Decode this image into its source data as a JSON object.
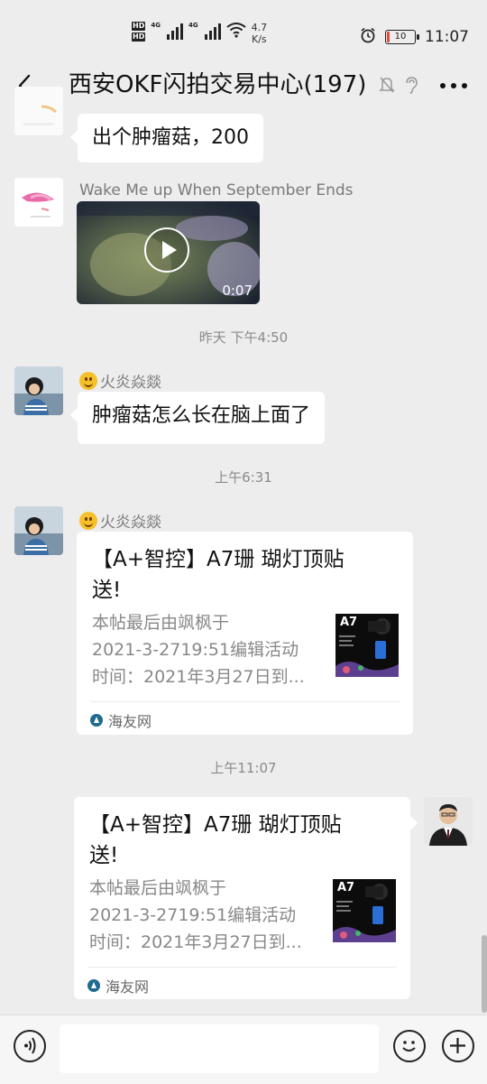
{
  "status_bar": {
    "hd1": "HD",
    "hd2": "HD",
    "net1": "4G",
    "net2": "4G",
    "speed_value": "4.7",
    "speed_unit": "K/s",
    "battery": "10",
    "time": "11:07"
  },
  "header": {
    "title": "西安OKF闪拍交易中心(197)"
  },
  "messages": {
    "m1_text": "出个肿瘤菇，200",
    "m2_sender": "Wake Me up When September Ends",
    "m2_video_duration": "0:07",
    "ts1": "昨天 下午4:50",
    "m3_sender": "火炎焱燚",
    "m3_text": "肿瘤菇怎么长在脑上面了",
    "ts2": "上午6:31",
    "m4_sender": "火炎焱燚",
    "m4_card": {
      "title": "【A+智控】A7珊 瑚灯顶贴送!",
      "desc_line1": "本帖最后由飒枫于",
      "desc_line2": "2021-3-2719:51编辑活动",
      "desc_line3": "时间：2021年3月27日到...",
      "source": "海友网",
      "thumb_label": "A7"
    },
    "ts3": "上午11:07",
    "m5_card": {
      "title": "【A+智控】A7珊 瑚灯顶贴送!",
      "desc_line1": "本帖最后由飒枫于",
      "desc_line2": "2021-3-2719:51编辑活动",
      "desc_line3": "时间：2021年3月27日到...",
      "source": "海友网",
      "thumb_label": "A7"
    }
  },
  "colors": {
    "chat_bg": "#ededed",
    "bubble": "#ffffff",
    "battery_low": "#e24a3b"
  }
}
